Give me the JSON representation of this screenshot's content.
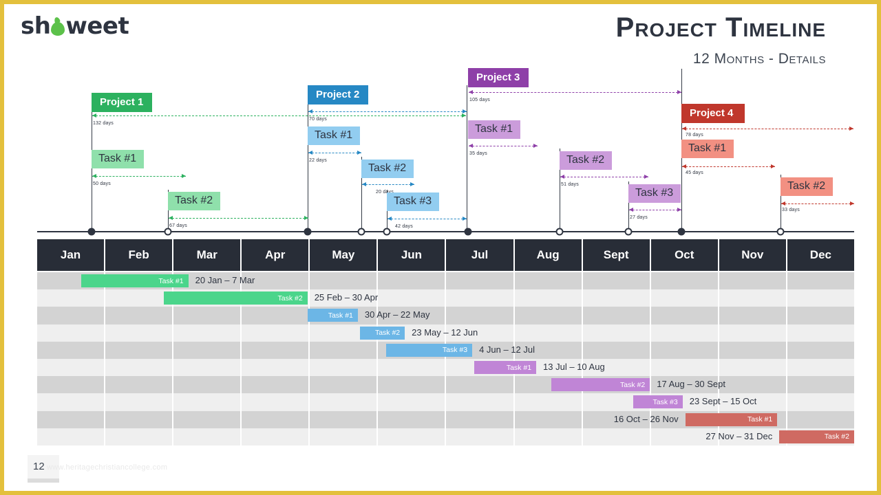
{
  "brand": {
    "logo_text_1": "sh",
    "logo_text_2": "weet"
  },
  "header": {
    "title": "Project Timeline",
    "subtitle": "12 Months - Details"
  },
  "footer": {
    "page_number": "12",
    "watermark": "www.heritagechristiancollege.com"
  },
  "colors": {
    "frame": "#e3c03c",
    "header_bar": "#282d37",
    "project1": "#2cb15f",
    "project1_light": "#8fe0ab",
    "project2": "#2688c4",
    "project2_light": "#92cdf0",
    "project3": "#8e3fa8",
    "project3_light": "#cb9cdb",
    "project4": "#c0372c",
    "project4_light": "#f29082",
    "gantt_bar_1": "#4bd58b",
    "gantt_bar_2": "#6cb6e6",
    "gantt_bar_3": "#c085d6",
    "gantt_bar_4": "#cf6a62",
    "row_odd": "#d3d3d3",
    "row_even": "#efefef"
  },
  "months": [
    "Jan",
    "Feb",
    "Mar",
    "Apr",
    "May",
    "Jun",
    "Jul",
    "Aug",
    "Sept",
    "Oct",
    "Nov",
    "Dec"
  ],
  "projects": [
    {
      "name": "Project 1",
      "duration": "132 days",
      "tasks": [
        {
          "name": "Task #1",
          "duration": "50 days"
        },
        {
          "name": "Task #2",
          "duration": "67 days"
        }
      ]
    },
    {
      "name": "Project 2",
      "duration": "70 days",
      "tasks": [
        {
          "name": "Task #1",
          "duration": "22 days"
        },
        {
          "name": "Task #2",
          "duration": "20 days"
        },
        {
          "name": "Task #3",
          "duration": "42 days"
        }
      ]
    },
    {
      "name": "Project 3",
      "duration": "105 days",
      "tasks": [
        {
          "name": "Task #1",
          "duration": "35 days"
        },
        {
          "name": "Task #2",
          "duration": "51 days"
        },
        {
          "name": "Task #3",
          "duration": "27 days"
        }
      ]
    },
    {
      "name": "Project 4",
      "duration": "78 days",
      "tasks": [
        {
          "name": "Task #1",
          "duration": "45 days"
        },
        {
          "name": "Task #2",
          "duration": "33 days"
        }
      ]
    }
  ],
  "chart_data": {
    "type": "bar",
    "title": "Project Timeline",
    "subtitle": "12 Months - Details",
    "xlabel": "",
    "ylabel": "",
    "categories": [
      "Jan",
      "Feb",
      "Mar",
      "Apr",
      "May",
      "Jun",
      "Jul",
      "Aug",
      "Sept",
      "Oct",
      "Nov",
      "Dec"
    ],
    "grid": true,
    "legend": "none",
    "series": [
      {
        "name": "Project 1",
        "color": "#4bd58b",
        "bars": [
          {
            "label": "Task #1",
            "date_range": "20 Jan – 7 Mar",
            "start_month": 0.65,
            "end_month": 2.22,
            "duration_days": 50
          },
          {
            "label": "Task #2",
            "date_range": "25 Feb – 30 Apr",
            "start_month": 1.86,
            "end_month": 3.97,
            "duration_days": 67
          }
        ]
      },
      {
        "name": "Project 2",
        "color": "#6cb6e6",
        "bars": [
          {
            "label": "Task #1",
            "date_range": "30 Apr – 22 May",
            "start_month": 3.97,
            "end_month": 4.71,
            "duration_days": 22
          },
          {
            "label": "Task #2",
            "date_range": "23 May – 12 Jun",
            "start_month": 4.74,
            "end_month": 5.4,
            "duration_days": 20
          },
          {
            "label": "Task #3",
            "date_range": "4 Jun – 12 Jul",
            "start_month": 5.13,
            "end_month": 6.39,
            "duration_days": 42
          }
        ]
      },
      {
        "name": "Project 3",
        "color": "#c085d6",
        "bars": [
          {
            "label": "Task #1",
            "date_range": "13 Jul – 10 Aug",
            "start_month": 6.42,
            "end_month": 7.33,
            "duration_days": 35
          },
          {
            "label": "Task #2",
            "date_range": "17 Aug – 30 Sept",
            "start_month": 7.55,
            "end_month": 9.0,
            "duration_days": 51
          },
          {
            "label": "Task #3",
            "date_range": "23 Sept – 15 Oct",
            "start_month": 8.75,
            "end_month": 9.48,
            "duration_days": 27
          }
        ]
      },
      {
        "name": "Project 4",
        "color": "#cf6a62",
        "bars": [
          {
            "label": "Task #1",
            "date_range": "16 Oct – 26 Nov",
            "start_month": 9.52,
            "end_month": 10.87,
            "duration_days": 45
          },
          {
            "label": "Task #2",
            "date_range": "27 Nov – 31 Dec",
            "start_month": 10.9,
            "end_month": 12.0,
            "duration_days": 33
          }
        ]
      }
    ],
    "gantt_rows": [
      {
        "task": "Task #1",
        "project": "Project 1",
        "date_range": "20 Jan – 7 Mar"
      },
      {
        "task": "Task #2",
        "project": "Project 1",
        "date_range": "25 Feb – 30 Apr"
      },
      {
        "task": "Task #1",
        "project": "Project 2",
        "date_range": "30 Apr – 22 May"
      },
      {
        "task": "Task #2",
        "project": "Project 2",
        "date_range": "23 May – 12 Jun"
      },
      {
        "task": "Task #3",
        "project": "Project 2",
        "date_range": "4 Jun – 12 Jul"
      },
      {
        "task": "Task #1",
        "project": "Project 3",
        "date_range": "13 Jul – 10 Aug"
      },
      {
        "task": "Task #2",
        "project": "Project 3",
        "date_range": "17 Aug – 30 Sept"
      },
      {
        "task": "Task #3",
        "project": "Project 3",
        "date_range": "23 Sept – 15 Oct"
      },
      {
        "task": "Task #1",
        "project": "Project 4",
        "date_range": "16 Oct – 26 Nov"
      },
      {
        "task": "Task #2",
        "project": "Project 4",
        "date_range": "27 Nov – 31 Dec"
      }
    ]
  }
}
